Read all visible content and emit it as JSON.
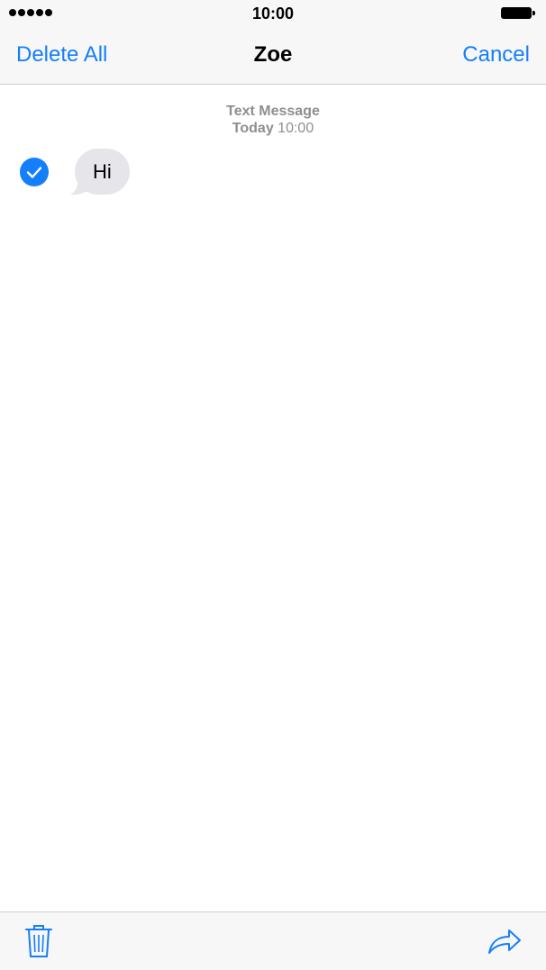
{
  "status_bar": {
    "time": "10:00"
  },
  "nav": {
    "left_label": "Delete All",
    "title": "Zoe",
    "right_label": "Cancel"
  },
  "conversation": {
    "header_type": "Text Message",
    "header_day": "Today",
    "header_time": "10:00",
    "messages": [
      {
        "text": "Hi",
        "selected": true
      }
    ]
  },
  "toolbar": {
    "left_icon": "trash-icon",
    "right_icon": "share-arrow-icon"
  },
  "colors": {
    "accent": "#147efb",
    "bubble": "#e5e5ea",
    "bar": "#f7f7f7",
    "meta_text": "#8e8e93"
  }
}
